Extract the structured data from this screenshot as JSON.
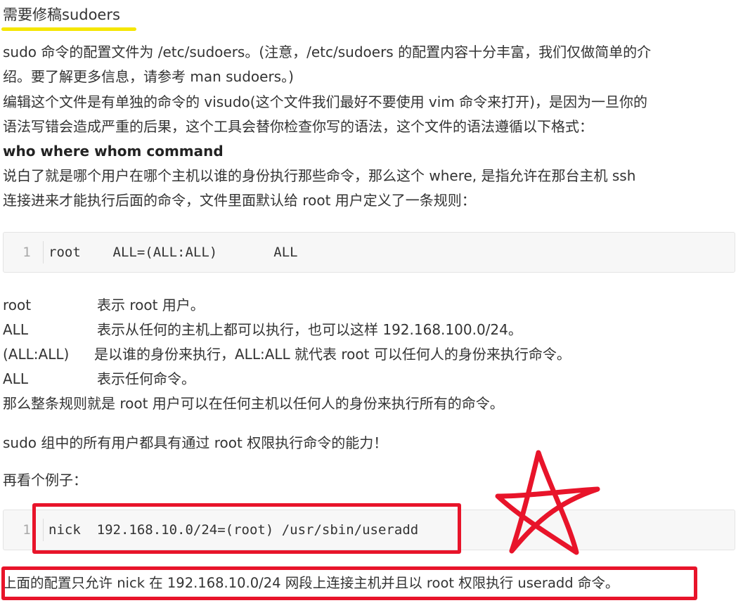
{
  "heading": "需要修稿sudoers",
  "para1": {
    "line1": "sudo 命令的配置文件为 /etc/sudoers。(注意，/etc/sudoers 的配置内容十分丰富，我们仅做简单的介",
    "line2": "绍。要了解更多信息，请参考 man sudoers。)"
  },
  "para2": {
    "line1": "编辑这个文件是有单独的命令的 visudo(这个文件我们最好不要使用 vim 命令来打开)，是因为一旦你的",
    "line2": "语法写错会造成严重的后果，这个工具会替你检查你写的语法，这个文件的语法遵循以下格式："
  },
  "syntax_bold": "who where whom command",
  "para3": {
    "line1": "说白了就是哪个用户在哪个主机以谁的身份执行那些命令，那么这个 where, 是指允许在那台主机 ssh",
    "line2": "连接进来才能执行后面的命令，文件里面默认给 root 用户定义了一条规则："
  },
  "code1": {
    "line_number": "1",
    "code": "root    ALL=(ALL:ALL)       ALL"
  },
  "definitions": [
    {
      "term": "root",
      "desc": "表示 root 用户。"
    },
    {
      "term": "ALL",
      "desc": "表示从任何的主机上都可以执行，也可以这样 192.168.100.0/24。"
    },
    {
      "term": "(ALL:ALL)",
      "desc": "是以谁的身份来执行，ALL:ALL 就代表 root 可以任何人的身份来执行命令。"
    },
    {
      "term": "ALL",
      "desc": "表示任何命令。"
    }
  ],
  "summary": "那么整条规则就是 root 用户可以在任何主机以任何人的身份来执行所有的命令。",
  "sudo_group": "sudo 组中的所有用户都具有通过 root 权限执行命令的能力！",
  "example_intro": "再看个例子：",
  "code2": {
    "line_number": "1",
    "code": "nick  192.168.10.0/24=(root) /usr/sbin/useradd"
  },
  "final": "上面的配置只允许 nick 在 192.168.10.0/24 网段上连接主机并且以 root 权限执行 useradd 命令。",
  "colors": {
    "highlight_underline": "#f5e600",
    "annotation_red": "#e8142a",
    "code_bg": "#f7f7f7"
  }
}
